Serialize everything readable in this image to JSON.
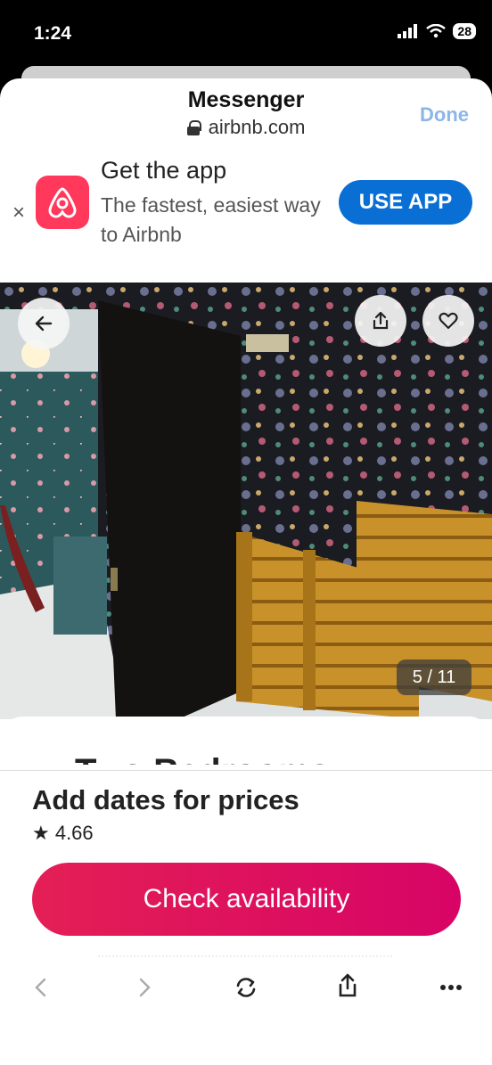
{
  "status": {
    "time": "1:24",
    "battery": "28"
  },
  "sheet": {
    "title": "Messenger",
    "url": "airbnb.com",
    "done_label": "Done"
  },
  "banner": {
    "title": "Get the app",
    "subtitle": "The fastest, easiest way to Airbnb",
    "button": "USE APP",
    "close": "×"
  },
  "photo": {
    "counter": "5 / 11"
  },
  "listing": {
    "title_peek": "Two Bedrooms",
    "price_text": "Add dates for prices",
    "rating": "★ 4.66",
    "cta": "Check availability"
  },
  "colors": {
    "brand": "#ff385c",
    "cta_start": "#e41f55",
    "cta_end": "#d70466",
    "use_app": "#0a6fd4",
    "done": "#8cb6e6"
  },
  "icons": [
    "back-arrow-icon",
    "share-icon",
    "heart-icon",
    "chevron-left-icon",
    "chevron-right-icon",
    "refresh-icon",
    "share-icon",
    "more-icon",
    "lock-icon",
    "airbnb-logo-icon",
    "signal-icon",
    "wifi-icon"
  ]
}
